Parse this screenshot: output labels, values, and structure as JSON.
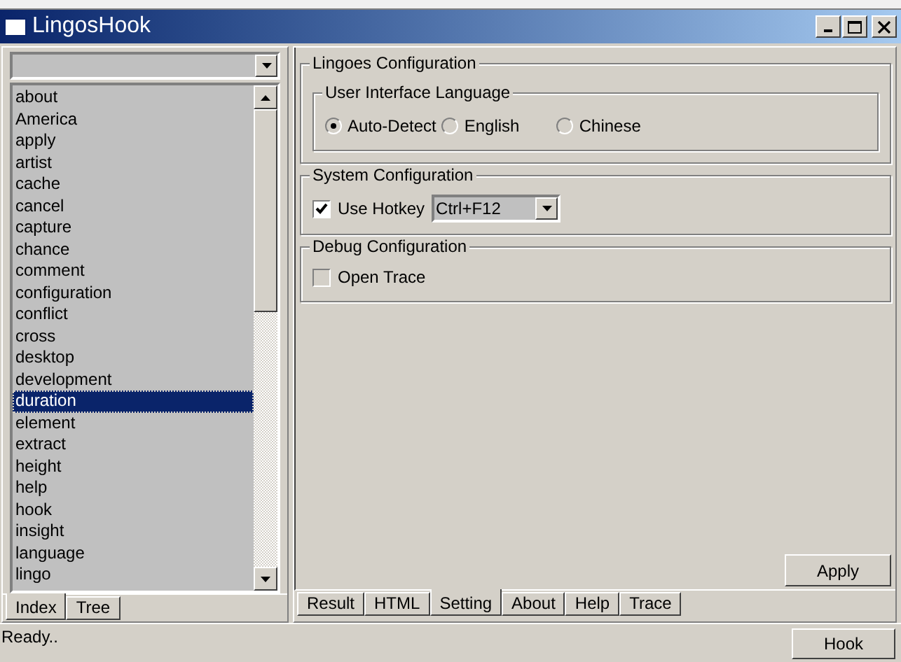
{
  "window": {
    "title": "LingosHook"
  },
  "index_panel": {
    "words": [
      {
        "label": "about",
        "selected": false
      },
      {
        "label": "America",
        "selected": false
      },
      {
        "label": "apply",
        "selected": false
      },
      {
        "label": "artist",
        "selected": false
      },
      {
        "label": "cache",
        "selected": false
      },
      {
        "label": "cancel",
        "selected": false
      },
      {
        "label": "capture",
        "selected": false
      },
      {
        "label": "chance",
        "selected": false
      },
      {
        "label": "comment",
        "selected": false
      },
      {
        "label": "configuration",
        "selected": false
      },
      {
        "label": "conflict",
        "selected": false
      },
      {
        "label": "cross",
        "selected": false
      },
      {
        "label": "desktop",
        "selected": false
      },
      {
        "label": "development",
        "selected": false
      },
      {
        "label": "duration",
        "selected": true
      },
      {
        "label": "element",
        "selected": false
      },
      {
        "label": "extract",
        "selected": false
      },
      {
        "label": "height",
        "selected": false
      },
      {
        "label": "help",
        "selected": false
      },
      {
        "label": "hook",
        "selected": false
      },
      {
        "label": "insight",
        "selected": false
      },
      {
        "label": "language",
        "selected": false
      },
      {
        "label": "lingo",
        "selected": false
      }
    ],
    "tabs": [
      {
        "label": "Index",
        "selected": true
      },
      {
        "label": "Tree",
        "selected": false
      }
    ]
  },
  "settings": {
    "lingoes_group": {
      "title": "Lingoes Configuration",
      "language_group": {
        "title": "User Interface Language",
        "options": [
          {
            "label": "Auto-Detect",
            "selected": true
          },
          {
            "label": "English",
            "selected": false
          },
          {
            "label": "Chinese",
            "selected": false
          }
        ]
      }
    },
    "system_group": {
      "title": "System Configuration",
      "use_hotkey": {
        "label": "Use Hotkey",
        "checked": true
      },
      "hotkey": "Ctrl+F12"
    },
    "debug_group": {
      "title": "Debug Configuration",
      "open_trace": {
        "label": "Open Trace",
        "checked": false
      }
    },
    "apply_button": "Apply"
  },
  "tabs": [
    {
      "label": "Result",
      "selected": false
    },
    {
      "label": "HTML",
      "selected": false
    },
    {
      "label": "Setting",
      "selected": true
    },
    {
      "label": "About",
      "selected": false
    },
    {
      "label": "Help",
      "selected": false
    },
    {
      "label": "Trace",
      "selected": false
    }
  ],
  "status_bar": {
    "text": "Ready..",
    "button": "Hook"
  }
}
